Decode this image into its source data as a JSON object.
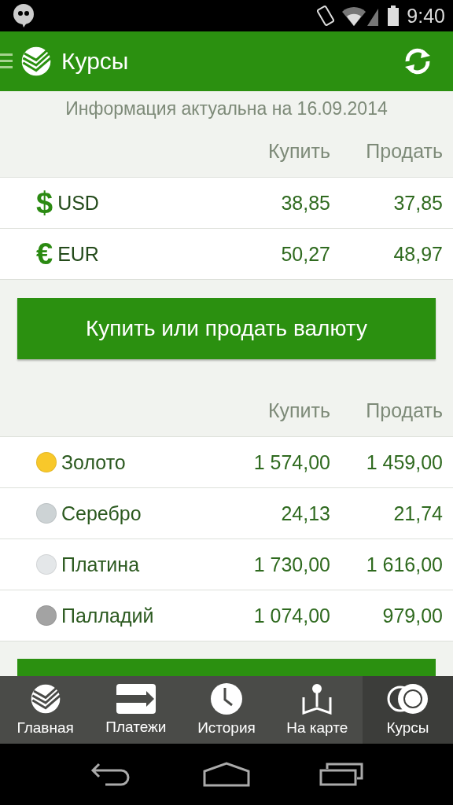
{
  "status_bar": {
    "time": "9:40"
  },
  "app_bar": {
    "title": "Курсы"
  },
  "info": "Информация актуальна на 16.09.2014",
  "currency_table": {
    "columns": [
      "Купить",
      "Продать"
    ],
    "rows": [
      {
        "symbol": "$",
        "name": "USD",
        "buy": "38,85",
        "sell": "37,85"
      },
      {
        "symbol": "€",
        "name": "EUR",
        "buy": "50,27",
        "sell": "48,97"
      }
    ]
  },
  "currency_button": "Купить или продать валюту",
  "metal_table": {
    "columns": [
      "Купить",
      "Продать"
    ],
    "rows": [
      {
        "name": "Золото",
        "color": "#f8c82a",
        "buy": "1 574,00",
        "sell": "1 459,00"
      },
      {
        "name": "Серебро",
        "color": "#cdd3d5",
        "buy": "24,13",
        "sell": "21,74"
      },
      {
        "name": "Платина",
        "color": "#e4e7e9",
        "buy": "1 730,00",
        "sell": "1 616,00"
      },
      {
        "name": "Палладий",
        "color": "#a3a3a3",
        "buy": "1 074,00",
        "sell": "979,00"
      }
    ]
  },
  "bottom_nav": [
    {
      "kind": "home",
      "label": "Главная",
      "selected": false
    },
    {
      "kind": "payments",
      "label": "Платежи",
      "selected": false
    },
    {
      "kind": "history",
      "label": "История",
      "selected": false
    },
    {
      "kind": "map",
      "label": "На карте",
      "selected": false
    },
    {
      "kind": "rates",
      "label": "Курсы",
      "selected": true
    }
  ]
}
